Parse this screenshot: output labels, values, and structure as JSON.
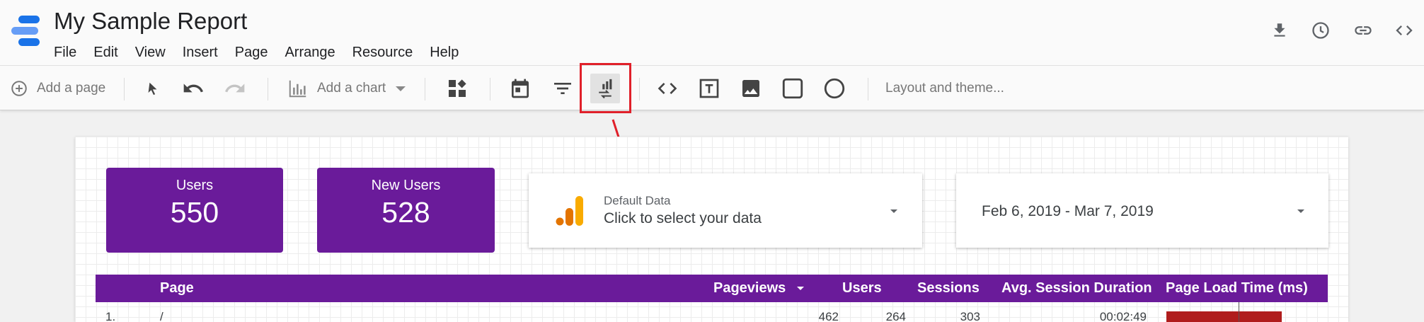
{
  "app": {
    "title": "My Sample Report",
    "menu": [
      "File",
      "Edit",
      "View",
      "Insert",
      "Page",
      "Arrange",
      "Resource",
      "Help"
    ],
    "header_icons": [
      "download-icon",
      "history-icon",
      "link-icon",
      "embed-code-icon"
    ]
  },
  "toolbar": {
    "add_page": "Add a page",
    "add_chart": "Add a chart",
    "layout_theme": "Layout and theme...",
    "tools": [
      "cursor-icon",
      "undo-icon",
      "redo-icon",
      "community-viz-icon",
      "date-range-icon",
      "filter-icon",
      "data-control-icon",
      "embed-url-icon",
      "text-box-icon",
      "image-icon",
      "rectangle-icon",
      "circle-icon"
    ],
    "highlighted_tool": "data-control-icon"
  },
  "scorecards": [
    {
      "label": "Users",
      "value": "550"
    },
    {
      "label": "New Users",
      "value": "528"
    }
  ],
  "data_control": {
    "label": "Default Data",
    "prompt": "Click to select your data"
  },
  "date_range": {
    "value": "Feb 6, 2019 - Mar 7, 2019"
  },
  "table": {
    "columns": [
      "Page",
      "Pageviews",
      "Users",
      "Sessions",
      "Avg. Session Duration",
      "Page Load Time (ms)"
    ],
    "sort_column": "Pageviews",
    "rows": [
      {
        "index": "1.",
        "page": "/",
        "pageviews": "462",
        "users": "264",
        "sessions": "303",
        "avg_session_duration": "00:02:49"
      }
    ]
  },
  "colors": {
    "accent": "#6a1b9a",
    "highlight": "#e0202a",
    "bar": "#b01d1d"
  }
}
